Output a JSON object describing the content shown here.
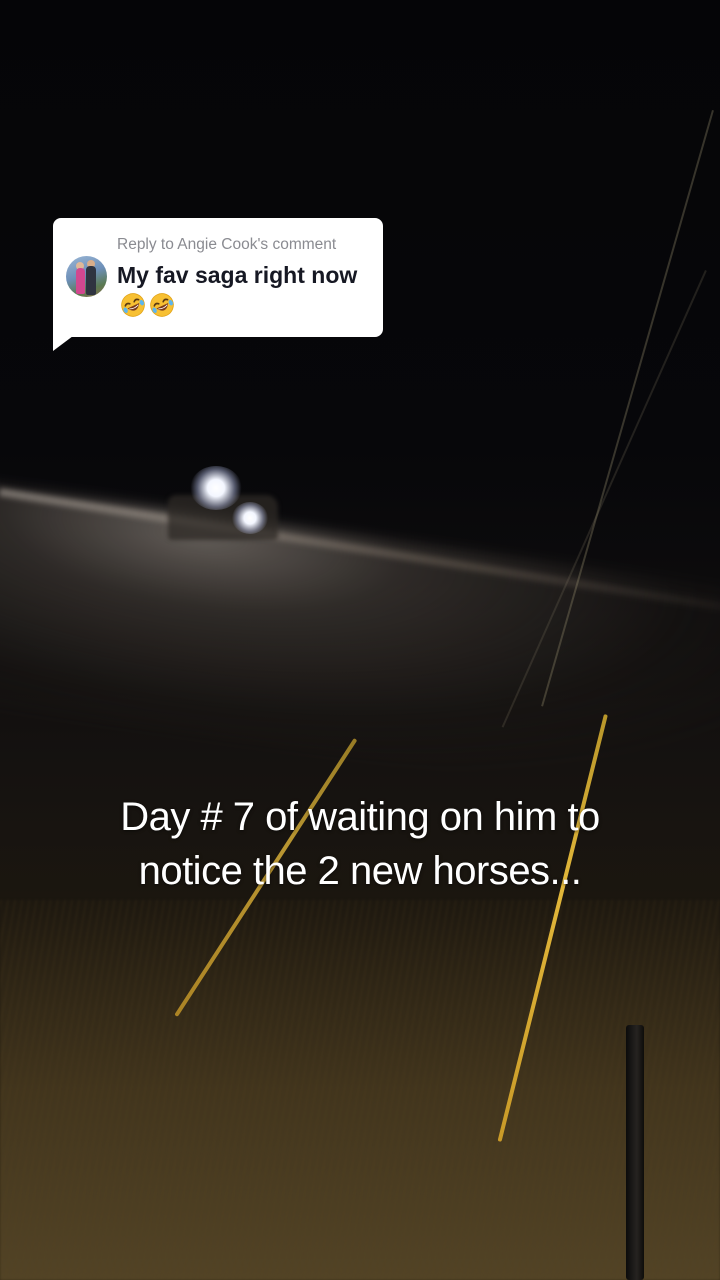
{
  "reply_bubble": {
    "header": "Reply to Angie Cook's comment",
    "text": "My fav saga right now",
    "emojis": [
      "rolling-on-floor-laughing-emoji",
      "rolling-on-floor-laughing-emoji"
    ]
  },
  "caption": {
    "line1": "Day # 7 of waiting on him to",
    "line2": "notice the 2 new horses..."
  },
  "colors": {
    "bubble_bg": "#ffffff",
    "header_text": "#8a8b91",
    "comment_text": "#161823",
    "caption_text": "#ffffff",
    "pole": "#e2b73a"
  }
}
